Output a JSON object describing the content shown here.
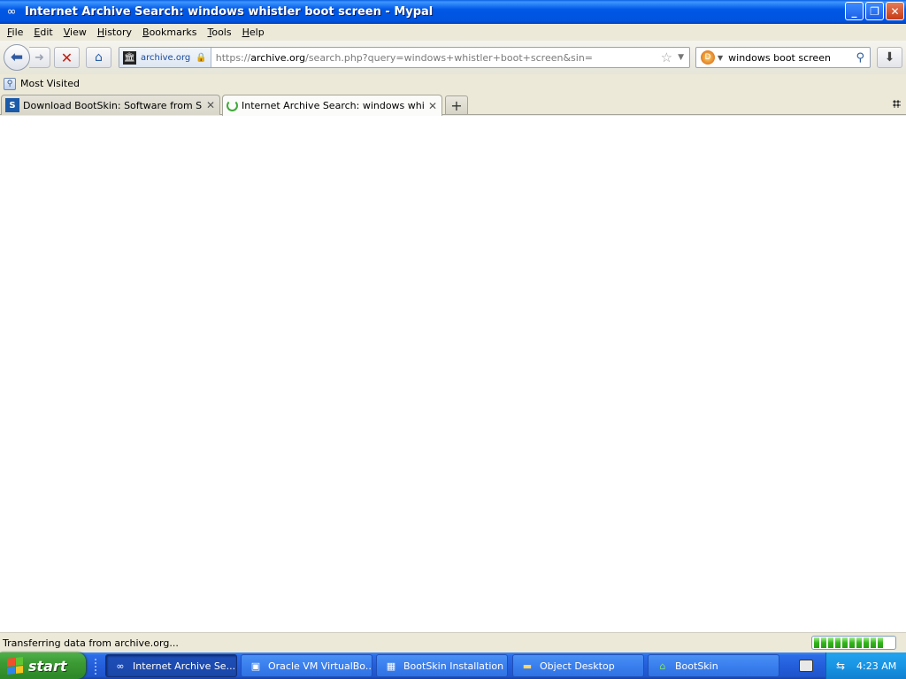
{
  "window": {
    "title": "Internet Archive Search: windows whistler boot screen - Mypal",
    "minimize_label": "_",
    "restore_label": "❐",
    "close_label": "✕"
  },
  "menu": [
    "File",
    "Edit",
    "View",
    "History",
    "Bookmarks",
    "Tools",
    "Help"
  ],
  "nav": {
    "site_identity": "archive.org",
    "url_prefix": "https://",
    "url_host": "archive.org",
    "url_path": "/search.php?query=windows+whistler+boot+screen&sin=",
    "search_value": "windows boot screen"
  },
  "bookmarks": {
    "most_visited": "Most Visited"
  },
  "tabs": [
    {
      "label": "Download BootSkin: Software from Stard...",
      "selected": false,
      "icon": "stardock-favicon"
    },
    {
      "label": "Internet Archive Search: windows whistl...",
      "selected": true,
      "icon": "loading-throbber"
    }
  ],
  "status": {
    "text": "Transferring data from archive.org...",
    "progress_fraction": 0.9
  },
  "taskbar": {
    "start_label": "start",
    "items": [
      {
        "label": "Internet Archive Se...",
        "active": true,
        "icon": "mypal-icon"
      },
      {
        "label": "Oracle VM VirtualBo...",
        "active": false,
        "icon": "virtualbox-icon"
      },
      {
        "label": "BootSkin Installation",
        "active": false,
        "icon": "installer-icon"
      },
      {
        "label": "Object Desktop",
        "active": false,
        "icon": "folder-icon"
      },
      {
        "label": "BootSkin",
        "active": false,
        "icon": "bootskin-icon"
      }
    ],
    "clock": "4:23 AM"
  }
}
